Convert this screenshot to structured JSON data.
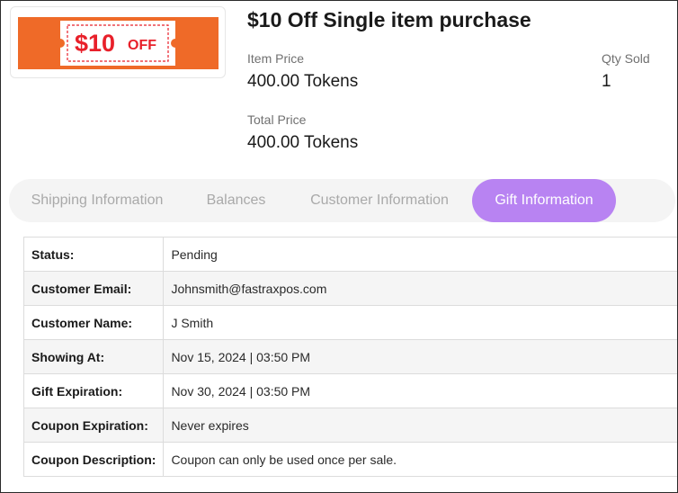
{
  "product": {
    "image": {
      "coupon_text": "$10",
      "coupon_suffix": "OFF",
      "background_color": "#ef6a28",
      "ticket_color": "#ffffff",
      "text_color": "#e8202a"
    },
    "title": "$10 Off Single item purchase",
    "item_price_label": "Item Price",
    "item_price_value": "400.00 Tokens",
    "qty_sold_label": "Qty Sold",
    "qty_sold_value": "1",
    "total_price_label": "Total Price",
    "total_price_value": "400.00 Tokens"
  },
  "tabs": [
    {
      "label": "Shipping Information",
      "active": false
    },
    {
      "label": "Balances",
      "active": false
    },
    {
      "label": "Customer Information",
      "active": false
    },
    {
      "label": "Gift Information",
      "active": true
    }
  ],
  "accent_color": "#b883f2",
  "gift_info": [
    {
      "label": "Status:",
      "value": "Pending"
    },
    {
      "label": "Customer Email:",
      "value": "Johnsmith@fastraxpos.com"
    },
    {
      "label": "Customer Name:",
      "value": "J Smith"
    },
    {
      "label": "Showing At:",
      "value": "Nov 15, 2024 | 03:50 PM"
    },
    {
      "label": "Gift Expiration:",
      "value": "Nov 30, 2024 | 03:50 PM"
    },
    {
      "label": "Coupon Expiration:",
      "value": "Never expires"
    },
    {
      "label": "Coupon Description:",
      "value": "Coupon can only be used once per sale."
    }
  ]
}
